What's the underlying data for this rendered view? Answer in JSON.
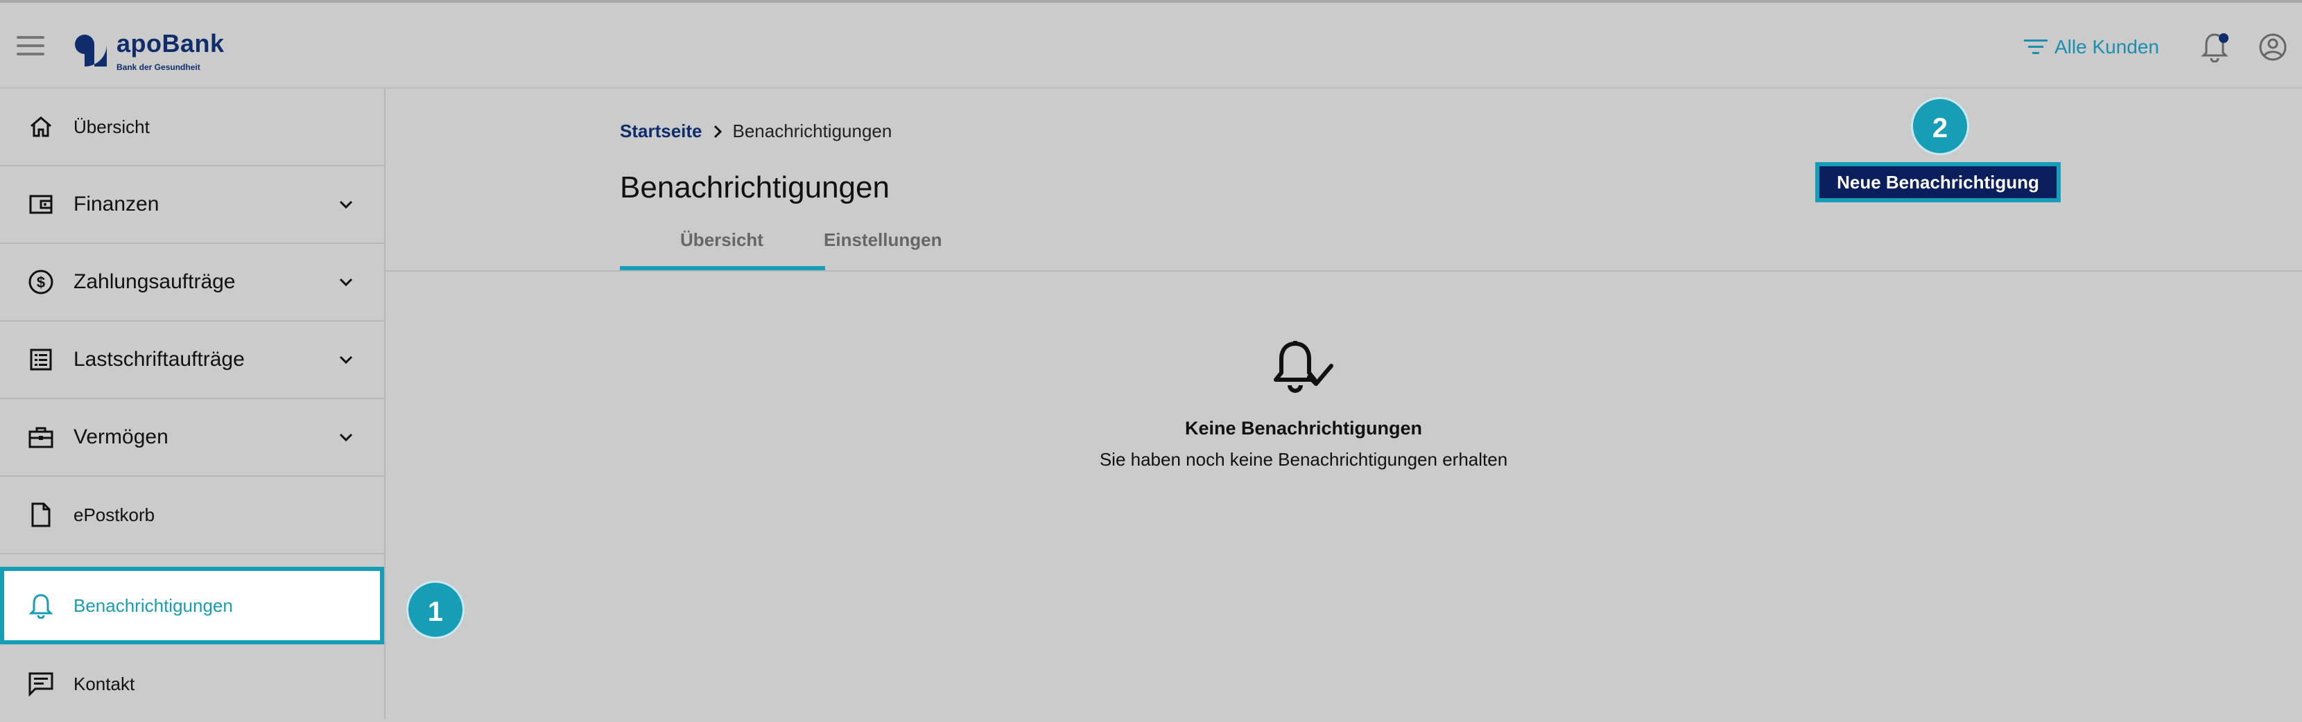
{
  "header": {
    "brand": "apoBank",
    "brand_sub": "Bank der Gesundheit",
    "filter_label": "Alle Kunden"
  },
  "sidebar": {
    "items": [
      {
        "label": "Übersicht",
        "icon": "home-icon"
      },
      {
        "label": "Finanzen",
        "icon": "wallet-icon"
      },
      {
        "label": "Zahlungsaufträge",
        "icon": "dollar-circle-icon"
      },
      {
        "label": "Lastschriftaufträge",
        "icon": "list-icon"
      },
      {
        "label": "Vermögen",
        "icon": "briefcase-icon"
      },
      {
        "label": "ePostkorb",
        "icon": "document-icon"
      },
      {
        "label": "Benachrichtigungen",
        "icon": "bell-icon"
      },
      {
        "label": "Kontakt",
        "icon": "chat-icon"
      }
    ]
  },
  "breadcrumb": {
    "home": "Startseite",
    "current": "Benachrichtigungen"
  },
  "page": {
    "title": "Benachrichtigungen",
    "tabs": [
      "Übersicht",
      "Einstellungen"
    ],
    "new_button": "Neue Benachrichtigung"
  },
  "empty_state": {
    "title": "Keine Benachrichtigungen",
    "text": "Sie haben noch keine Benachrichtigungen erhalten"
  },
  "callouts": {
    "one": "1",
    "two": "2"
  },
  "colors": {
    "accent": "#179db5",
    "brand": "#0f2d6b",
    "button": "#0a1e5c"
  }
}
